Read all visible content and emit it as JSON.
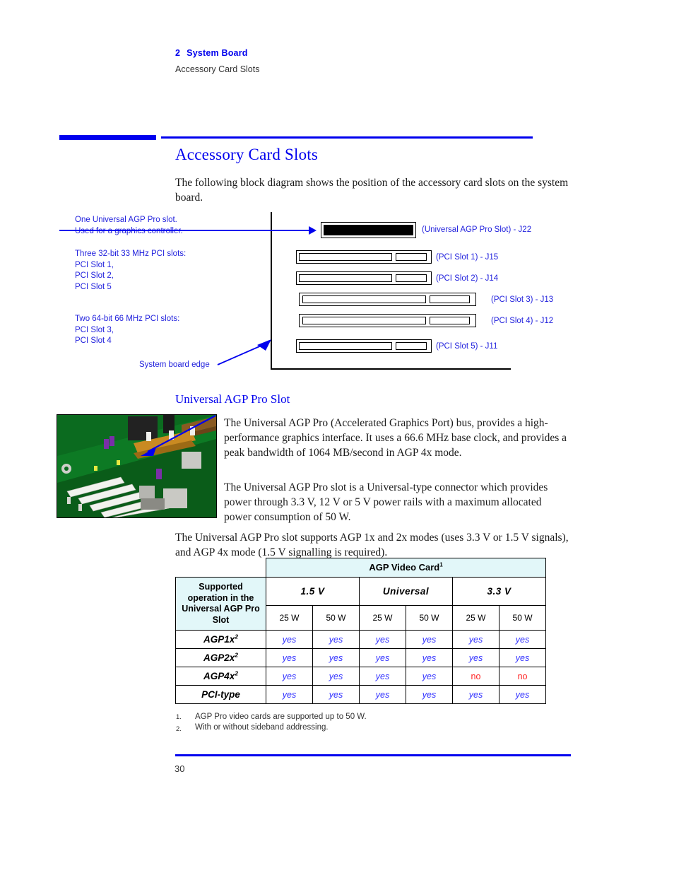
{
  "running_head": {
    "chapter_number": "2",
    "chapter_title": "System Board",
    "section": "Accessory Card Slots"
  },
  "page": {
    "title": "Accessory Card Slots",
    "number": "30"
  },
  "intro_paragraph": "The following block diagram shows the position of the accessory card slots on the system board.",
  "diagram": {
    "left_labels": {
      "agp_line1": "One Universal AGP Pro slot.",
      "agp_line2": "Used for a graphics controller.",
      "pci32_line1": "Three 32-bit 33 MHz PCI slots:",
      "pci32_line2": "PCI Slot 1,",
      "pci32_line3": "PCI Slot 2,",
      "pci32_line4": "PCI Slot 5",
      "pci64_line1": "Two 64-bit 66 MHz PCI slots:",
      "pci64_line2": "PCI Slot 3,",
      "pci64_line3": "PCI Slot 4",
      "board_edge": "System board edge"
    },
    "slots": [
      {
        "label": "(Universal AGP Pro Slot) - J22",
        "type": "agp"
      },
      {
        "label": "(PCI Slot 1) - J15",
        "type": "pci32"
      },
      {
        "label": "(PCI Slot 2) - J14",
        "type": "pci32"
      },
      {
        "label": "(PCI Slot 3) - J13",
        "type": "pci64"
      },
      {
        "label": "(PCI Slot 4) - J12",
        "type": "pci64"
      },
      {
        "label": "(PCI Slot 5) - J11",
        "type": "pci32"
      }
    ]
  },
  "subsection": {
    "heading": "Universal AGP Pro Slot",
    "paragraph_1": "The Universal AGP Pro (Accelerated Graphics Port) bus, provides a high-performance graphics interface. It uses a 66.6 MHz base clock, and provides a peak bandwidth of 1064 MB/second in AGP 4x mode.",
    "paragraph_2": "The Universal AGP Pro slot is a Universal-type connector which provides power through 3.3 V, 12 V or 5 V power rails with a maximum allocated power consumption of 50 W.",
    "paragraph_3": "The Universal AGP Pro slot supports AGP 1x and 2x modes (uses 3.3 V or 1.5 V signals), and AGP 4x mode (1.5 V signalling is required)."
  },
  "table": {
    "top_header": "AGP Video Card",
    "top_header_footnote": "1",
    "row_header": "Supported operation in the Universal AGP Pro Slot",
    "voltage_groups": [
      "1.5  V",
      "Universal",
      "3.3  V"
    ],
    "power_columns": [
      "25 W",
      "50 W",
      "25 W",
      "50 W",
      "25 W",
      "50 W"
    ],
    "rows": [
      {
        "mode": "AGP1x",
        "footnote": "2",
        "values": [
          "yes",
          "yes",
          "yes",
          "yes",
          "yes",
          "yes"
        ]
      },
      {
        "mode": "AGP2x",
        "footnote": "2",
        "values": [
          "yes",
          "yes",
          "yes",
          "yes",
          "yes",
          "yes"
        ]
      },
      {
        "mode": "AGP4x",
        "footnote": "2",
        "values": [
          "yes",
          "yes",
          "yes",
          "yes",
          "no",
          "no"
        ]
      },
      {
        "mode": "PCI-type",
        "footnote": "",
        "values": [
          "yes",
          "yes",
          "yes",
          "yes",
          "yes",
          "yes"
        ]
      }
    ]
  },
  "footnotes": [
    {
      "number": "1.",
      "text": "AGP Pro video cards are supported up to 50 W."
    },
    {
      "number": "2.",
      "text": "With or without sideband addressing."
    }
  ],
  "colors": {
    "accent_blue": "#0000EE",
    "label_blue": "#2222DD",
    "yes_blue": "#3333FF",
    "no_red": "#FF2222",
    "table_header_cyan": "#E2F7F9"
  }
}
